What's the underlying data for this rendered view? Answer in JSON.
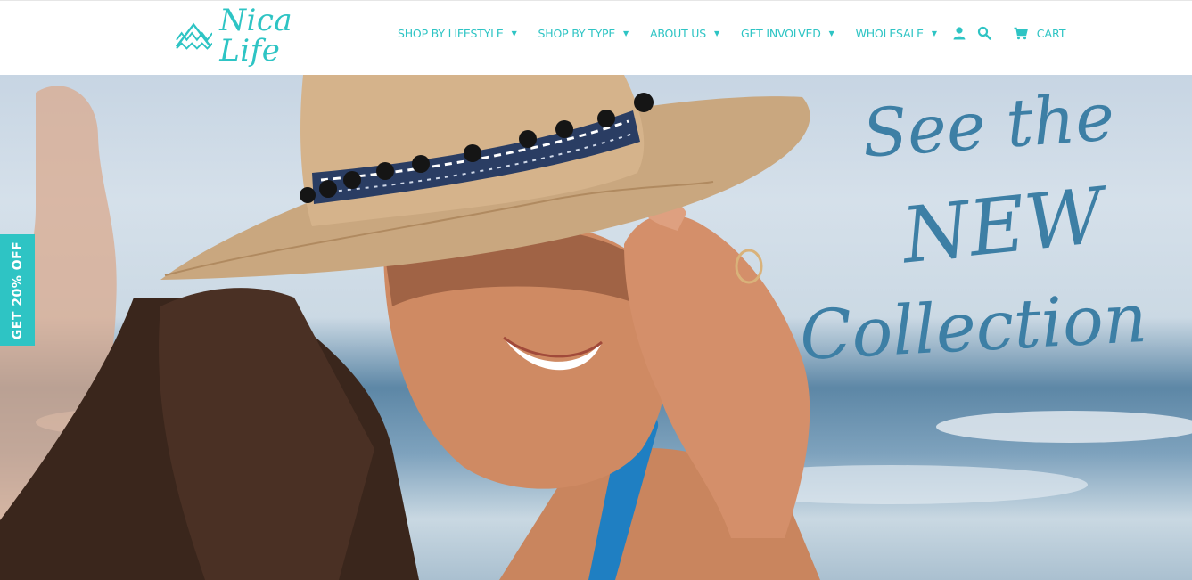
{
  "header": {
    "logo_text": "Nica Life",
    "nav": [
      {
        "label": "SHOP BY LIFESTYLE"
      },
      {
        "label": "SHOP BY TYPE"
      },
      {
        "label": "ABOUT US"
      },
      {
        "label": "GET INVOLVED"
      },
      {
        "label": "WHOLESALE"
      }
    ],
    "icons": [
      "account-icon",
      "search-icon",
      "cart-icon"
    ],
    "cart_label": "CART"
  },
  "hero": {
    "line1": "See the",
    "line2": "NEW",
    "line3": "Collection"
  },
  "promo_tab": {
    "label": "GET 20% OFF"
  },
  "colors": {
    "accent": "#2ec4c4",
    "hero_script": "#3d7fa5"
  }
}
